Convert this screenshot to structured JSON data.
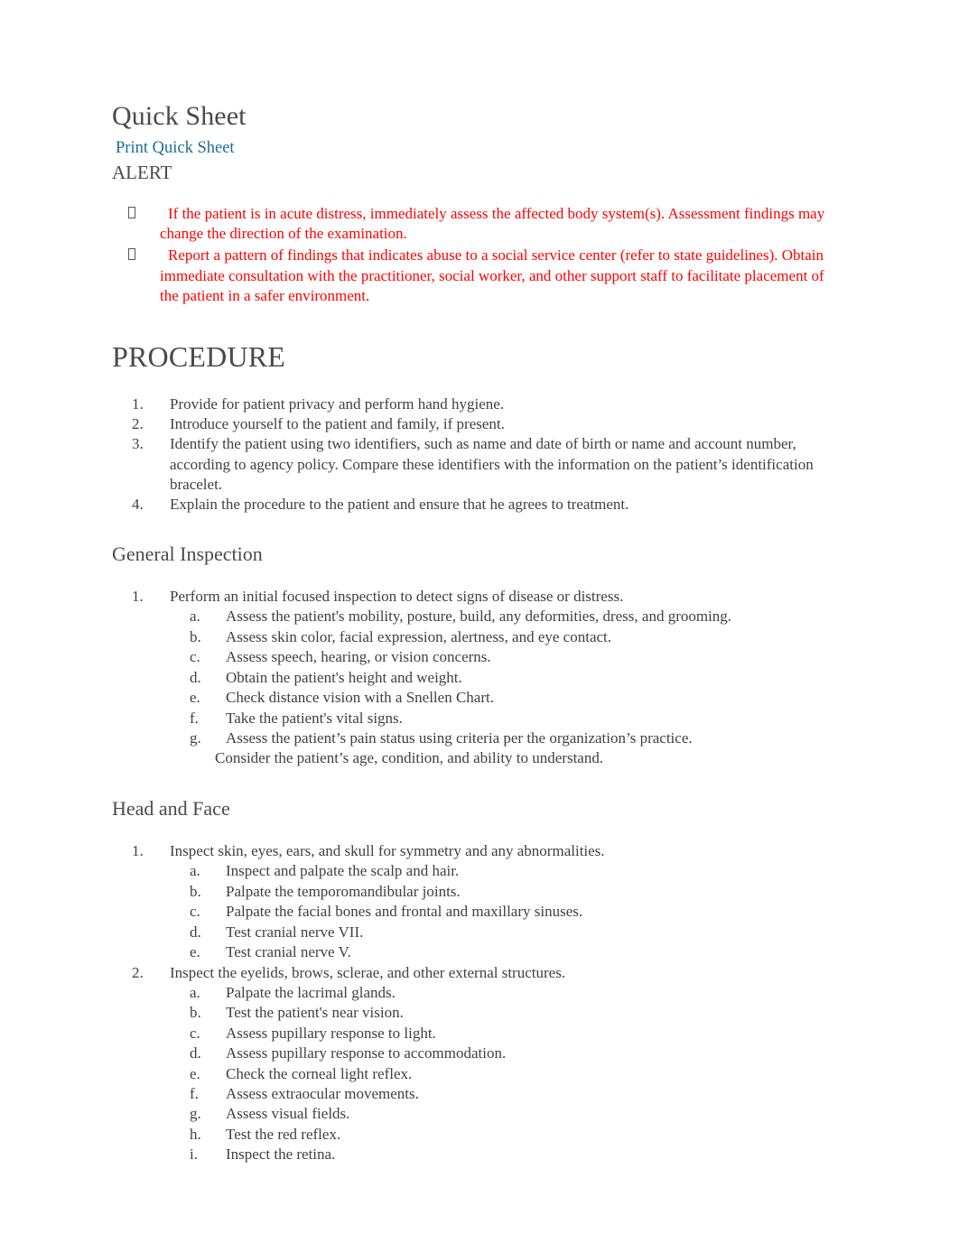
{
  "document": {
    "title": "Quick Sheet",
    "print_link": "Print Quick Sheet",
    "alert_heading": "ALERT",
    "bullet_glyph": "missing-glyph-box"
  },
  "colors": {
    "alert_text": "#ff0000",
    "link": "#1a6e92",
    "heading": "#4a4a4a",
    "body": "#404040",
    "background": "#ffffff"
  },
  "alert": {
    "items": [
      "If the patient is in acute distress, immediately assess the affected body system(s). Assessment findings may change the direction of the examination.",
      "Report a pattern of findings that indicates abuse to a social service center (refer to state guidelines). Obtain immediate consultation with the practitioner, social worker, and other support staff to facilitate placement of the patient in a safer environment."
    ]
  },
  "procedure": {
    "heading": "PROCEDURE",
    "steps": [
      {
        "marker": "1.",
        "text": "Provide for patient privacy and perform hand hygiene."
      },
      {
        "marker": "2.",
        "text": "Introduce yourself to the patient and family, if present."
      },
      {
        "marker": "3.",
        "text": "Identify the patient using two identifiers, such as name and date of birth or name and account number, according to agency policy. Compare these identifiers with the information on the patient’s identification bracelet."
      },
      {
        "marker": "4.",
        "text": "Explain the procedure to the patient and ensure that he agrees to treatment."
      }
    ]
  },
  "general_inspection": {
    "heading": "General Inspection",
    "steps": [
      {
        "marker": "1.",
        "text": "Perform an initial focused inspection to detect signs of disease or distress.",
        "substeps": [
          {
            "marker": "a.",
            "text": "Assess the patient's mobility, posture, build, any deformities, dress, and grooming."
          },
          {
            "marker": "b.",
            "text": "Assess skin color, facial expression, alertness, and eye contact."
          },
          {
            "marker": "c.",
            "text": "Assess speech, hearing, or vision concerns."
          },
          {
            "marker": "d.",
            "text": "Obtain the patient's height and weight."
          },
          {
            "marker": "e.",
            "text": "Check distance vision with a Snellen Chart."
          },
          {
            "marker": "f.",
            "text": "Take the patient's vital signs."
          },
          {
            "marker": "g.",
            "text": "Assess the patient’s pain status using criteria per the organization’s practice.",
            "continuation": "Consider the patient’s age, condition, and ability to understand."
          }
        ]
      }
    ]
  },
  "head_and_face": {
    "heading": "Head and Face",
    "steps": [
      {
        "marker": "1.",
        "text": "Inspect skin, eyes, ears, and skull for symmetry and any abnormalities.",
        "substeps": [
          {
            "marker": "a.",
            "text": "Inspect and palpate the scalp and hair."
          },
          {
            "marker": "b.",
            "text": "Palpate the temporomandibular joints."
          },
          {
            "marker": "c.",
            "text": "Palpate the facial bones and frontal and maxillary sinuses."
          },
          {
            "marker": "d.",
            "text": "Test cranial nerve VII."
          },
          {
            "marker": "e.",
            "text": "Test cranial nerve V."
          }
        ]
      },
      {
        "marker": "2.",
        "text": "Inspect the eyelids, brows, sclerae, and other external structures.",
        "substeps": [
          {
            "marker": "a.",
            "text": "Palpate the lacrimal glands."
          },
          {
            "marker": "b.",
            "text": "Test the patient's near vision."
          },
          {
            "marker": "c.",
            "text": "Assess pupillary response to light."
          },
          {
            "marker": "d.",
            "text": "Assess pupillary response to accommodation."
          },
          {
            "marker": "e.",
            "text": "Check the corneal light reflex."
          },
          {
            "marker": "f.",
            "text": "Assess extraocular movements."
          },
          {
            "marker": "g.",
            "text": "Assess visual fields."
          },
          {
            "marker": "h.",
            "text": "Test the red reflex."
          },
          {
            "marker": "i.",
            "text": "Inspect the retina."
          }
        ]
      }
    ]
  }
}
